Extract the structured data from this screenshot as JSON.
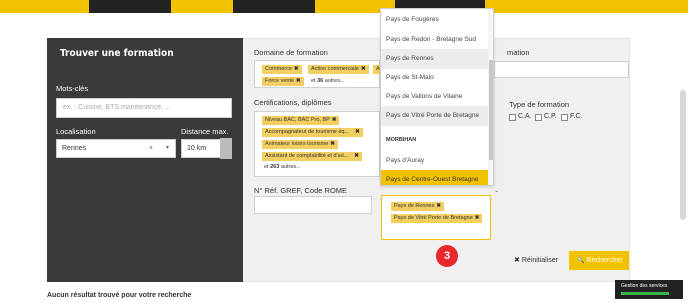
{
  "header": {
    "left_panel_title": "Trouver une formation"
  },
  "left": {
    "keywords_label": "Mots-clés",
    "keywords_placeholder": "ex. : Cuisine, BTS maintenance, ...",
    "location_label": "Localisation",
    "distance_label": "Distance max.",
    "location_value": "Rennes",
    "location_clear": "×",
    "location_arrow": "▾",
    "distance_value": "10 km"
  },
  "middle": {
    "domain_label": "Domaine de formation",
    "domain_tags": [
      "Commerce",
      "Action commerciale",
      "A",
      "Force vente"
    ],
    "domain_more_prefix": "et",
    "domain_more_count": "36",
    "domain_more_suffix": "autres...",
    "cert_label": "Certifications, diplômes",
    "cert_tags": [
      "Niveau BAC, BAC Pro, BP",
      "Accompagnateur de tourisme éq...",
      "Animateur loisirs tourisme",
      "Assistant de comptabilité et d'ad..."
    ],
    "cert_more_prefix": "et",
    "cert_more_count": "263",
    "cert_more_suffix": "autres...",
    "ref_label": "N° Réf. GREF, Code ROME"
  },
  "right": {
    "mation_label": "mation",
    "type_label": "Type de formation",
    "type_options": [
      "C.A.",
      "C.P.",
      "F.C."
    ]
  },
  "dropdown": {
    "items_top": [
      "Pays de Fougères",
      "Pays de Redon - Bretagne Sud",
      "Pays de Rennes",
      "Pays de St-Malo",
      "Pays de Vallons de Vilaine",
      "Pays de Vitré Porte de Bretagne"
    ],
    "group": "MORBIHAN",
    "items_bottom": [
      "Pays d'Auray",
      "Pays de Centre-Ouest Bretagne"
    ],
    "chosen": [
      "Pays de Rennes",
      "Pays de Vitré Porte de Bretagne"
    ],
    "scroll_arrow": "⌄"
  },
  "actions": {
    "step_badge": "3",
    "reset_icon": "✖",
    "reset_label": "Réinitialiser",
    "search_icon": "🔍",
    "search_label": "Rechercher"
  },
  "results": {
    "no_result": "Aucun résultat trouvé pour votre recherche"
  },
  "cookie": {
    "label": "Gestion des services"
  },
  "colors": {
    "accent": "#f2c200",
    "panel_dark": "#3a3a3a",
    "tag": "#f2cf60",
    "badge": "#e8262b"
  }
}
